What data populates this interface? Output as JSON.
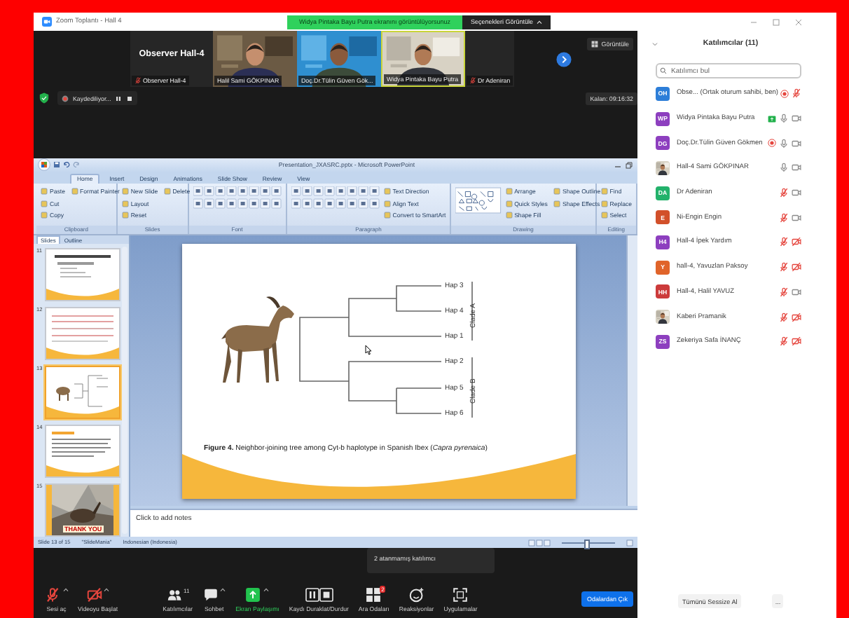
{
  "window": {
    "title": "Zoom Toplantı - Hall 4"
  },
  "share_banner": {
    "text": "Widya Pintaka Bayu Putra ekranını görüntülüyorsunuz",
    "options": "Seçenekleri Görüntüle"
  },
  "videos": [
    {
      "kind": "name",
      "title": "Observer Hall-4",
      "name": "Observer Hall-4",
      "muted": true,
      "speaking": false
    },
    {
      "kind": "picture",
      "name": "Halil Sami GÖKPINAR",
      "muted": false,
      "speaking": false
    },
    {
      "kind": "picture",
      "name": "Doç.Dr.Tülin Güven Gök...",
      "muted": false,
      "speaking": false
    },
    {
      "kind": "picture",
      "name": "Widya Pintaka Bayu Putra",
      "muted": false,
      "speaking": true
    },
    {
      "kind": "blank",
      "name": "Dr Adeniran",
      "muted": true,
      "speaking": false
    }
  ],
  "view_button": "Görüntüle",
  "recording": {
    "label": "Kaydediliyor..."
  },
  "time_left": "Kalan: 09:16:32",
  "ppt": {
    "title": "Presentation_JXASRC.pptx - Microsoft PowerPoint",
    "tabs": [
      {
        "label": "Home",
        "selected": true
      },
      {
        "label": "Insert",
        "selected": false
      },
      {
        "label": "Design",
        "selected": false
      },
      {
        "label": "Animations",
        "selected": false
      },
      {
        "label": "Slide Show",
        "selected": false
      },
      {
        "label": "Review",
        "selected": false
      },
      {
        "label": "View",
        "selected": false
      }
    ],
    "ribbon_groups": [
      {
        "name": "Clipboard",
        "kind": "buttons",
        "items": [
          "Paste",
          "Cut",
          "Copy",
          "Format Painter"
        ]
      },
      {
        "name": "Slides",
        "kind": "buttons",
        "items": [
          "New Slide",
          "Layout",
          "Reset",
          "Delete"
        ]
      },
      {
        "name": "Font",
        "kind": "formatting"
      },
      {
        "name": "Paragraph",
        "kind": "formatting",
        "items": [
          "Text Direction",
          "Align Text",
          "Convert to SmartArt"
        ]
      },
      {
        "name": "Drawing",
        "kind": "shapes",
        "items": [
          "Arrange",
          "Quick Styles",
          "Shape Fill",
          "Shape Outline",
          "Shape Effects"
        ]
      },
      {
        "name": "Editing",
        "kind": "buttons",
        "items": [
          "Find",
          "Replace",
          "Select"
        ]
      }
    ],
    "pane_tabs": [
      {
        "label": "Slides",
        "selected": true
      },
      {
        "label": "Outline",
        "selected": false
      }
    ],
    "thumbnails": [
      {
        "number": "11",
        "kind": "table",
        "selected": false
      },
      {
        "number": "12",
        "kind": "lines",
        "selected": false
      },
      {
        "number": "13",
        "kind": "tree",
        "selected": true
      },
      {
        "number": "14",
        "kind": "text",
        "selected": false
      },
      {
        "number": "15",
        "selected": false,
        "caption": "THANK YOU"
      }
    ],
    "slide": {
      "leaves": [
        "Hap 3",
        "Hap 4",
        "Hap 1",
        "Hap 2",
        "Hap 5",
        "Hap 6"
      ],
      "clades": [
        "Clade A",
        "Clade B"
      ],
      "caption": "**Figure 4.** Neighbor-joining tree among Cyt-b haplotype in Spanish Ibex (*Capra pyrenaica*)"
    },
    "notes_placeholder": "Click to add notes",
    "status": [
      "Slide 13 of 15",
      "\"SlideMania\"",
      "Indonesian (Indonesia)"
    ],
    "zoom_slider": {
      "level": 0.45
    }
  },
  "tooltip": "2 atanmamış katılımcı",
  "toolbar": [
    {
      "kind": "mic",
      "label": "Sesi aç",
      "off": true
    },
    {
      "kind": "camera",
      "label": "Videoyu Başlat",
      "off": true
    },
    {
      "kind": "people",
      "label": "Katılımcılar",
      "count": "11"
    },
    {
      "kind": "chat",
      "label": "Sohbet"
    },
    {
      "kind": "share",
      "label": "Ekran Paylaşımı",
      "active": true
    },
    {
      "kind": "record",
      "label": "Kaydı Duraklat/Durdur"
    },
    {
      "kind": "rooms",
      "label": "Ara Odaları",
      "badge": "2"
    },
    {
      "kind": "reactions",
      "label": "Reaksiyonlar"
    },
    {
      "kind": "apps",
      "label": "Uygulamalar"
    }
  ],
  "leave_button": "Odalardan Çık",
  "participants_panel": {
    "title": "Katılımcılar (11)",
    "search_placeholder": "Katılımcı bul",
    "participants": [
      {
        "kind": "initials",
        "initials": "OH",
        "color": "#2d7ed8",
        "name": "Obse... (Ortak oturum sahibi, ben)",
        "recording": true,
        "sharing": false,
        "muted": true
      },
      {
        "kind": "initials",
        "initials": "WP",
        "color": "#8d3fbf",
        "name": "Widya Pintaka Bayu Putra",
        "recording": false,
        "sharing": true,
        "muted": false,
        "video_off": false
      },
      {
        "kind": "initials",
        "initials": "DG",
        "color": "#8d3fbf",
        "name": "Doç.Dr.Tülin Güven Gökmen",
        "recording": true,
        "sharing": false,
        "muted": false,
        "video_off": false
      },
      {
        "kind": "picture",
        "name": "Hall-4 Sami GÖKPINAR",
        "recording": false,
        "sharing": false,
        "muted": false,
        "video_off": false
      },
      {
        "kind": "initials",
        "initials": "DA",
        "color": "#23b26b",
        "name": "Dr Adeniran",
        "recording": false,
        "sharing": false,
        "muted": true,
        "video_off": false
      },
      {
        "kind": "initials",
        "initials": "E",
        "color": "#d2502a",
        "name": "Ni-Engin Engin",
        "recording": false,
        "sharing": false,
        "muted": true,
        "video_off": false
      },
      {
        "kind": "initials",
        "initials": "H4",
        "color": "#8d3fbf",
        "name": "Hall-4 İpek Yardım",
        "recording": false,
        "sharing": false,
        "muted": true,
        "video_off": true
      },
      {
        "kind": "initials",
        "initials": "Y",
        "color": "#e0642a",
        "name": "hall-4, Yavuzlan Paksoy",
        "recording": false,
        "sharing": false,
        "muted": true,
        "video_off": true
      },
      {
        "kind": "initials",
        "initials": "HH",
        "color": "#cc3b3b",
        "name": "Hall-4, Halil YAVUZ",
        "recording": false,
        "sharing": false,
        "muted": true,
        "video_off": false
      },
      {
        "kind": "picture",
        "name": "Kaberi Pramanik",
        "recording": false,
        "sharing": false,
        "muted": true,
        "video_off": true
      },
      {
        "kind": "initials",
        "initials": "ZS",
        "color": "#8d3fbf",
        "name": "Zekeriya Safa İNANÇ",
        "recording": false,
        "sharing": false,
        "muted": true,
        "video_off": true
      }
    ],
    "mute_all": "Tümünü Sessize Al",
    "more": "..."
  }
}
